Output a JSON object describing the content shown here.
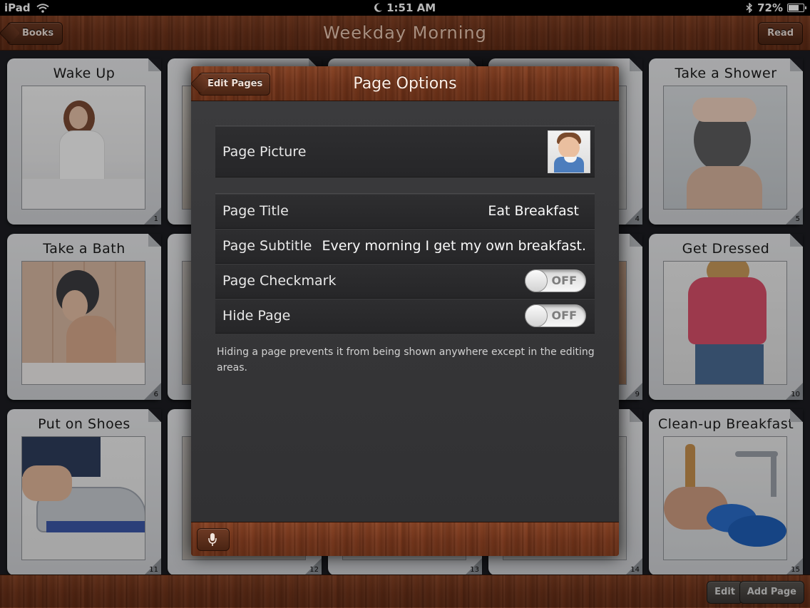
{
  "status_bar": {
    "device": "iPad",
    "time": "1:51 AM",
    "battery": "72%"
  },
  "nav": {
    "title": "Weekday Morning",
    "back_label": "Books",
    "read_label": "Read"
  },
  "grid": {
    "cards": [
      {
        "title": "Wake Up",
        "number": "1"
      },
      {
        "title": "",
        "number": ""
      },
      {
        "title": "",
        "number": ""
      },
      {
        "title": "",
        "number": "4"
      },
      {
        "title": "Take a Shower",
        "number": "5"
      },
      {
        "title": "Take a Bath",
        "number": "6"
      },
      {
        "title": "",
        "number": ""
      },
      {
        "title": "",
        "number": ""
      },
      {
        "title": "",
        "number": "9"
      },
      {
        "title": "Get Dressed",
        "number": "10"
      },
      {
        "title": "Put on Shoes",
        "number": "11"
      },
      {
        "title": "",
        "number": "12"
      },
      {
        "title": "",
        "number": "13"
      },
      {
        "title": "",
        "number": "14"
      },
      {
        "title": "Clean-up Breakfast",
        "number": "15"
      }
    ]
  },
  "bottom_bar": {
    "edit_label": "Edit",
    "add_page_label": "Add Page"
  },
  "modal": {
    "title": "Page Options",
    "back_label": "Edit Pages",
    "page_picture_label": "Page Picture",
    "page_title_label": "Page Title",
    "page_title_value": "Eat Breakfast",
    "page_subtitle_label": "Page Subtitle",
    "page_subtitle_value": "Every morning I get my own breakfast.",
    "page_checkmark_label": "Page Checkmark",
    "page_checkmark_state": "OFF",
    "hide_page_label": "Hide Page",
    "hide_page_state": "OFF",
    "hide_help": "Hiding a page prevents it from being shown anywhere except in the editing areas."
  },
  "icons": {
    "wifi": "wifi-icon",
    "moon": "moon-icon",
    "bluetooth": "bluetooth-icon",
    "battery": "battery-icon",
    "microphone": "microphone-icon"
  }
}
